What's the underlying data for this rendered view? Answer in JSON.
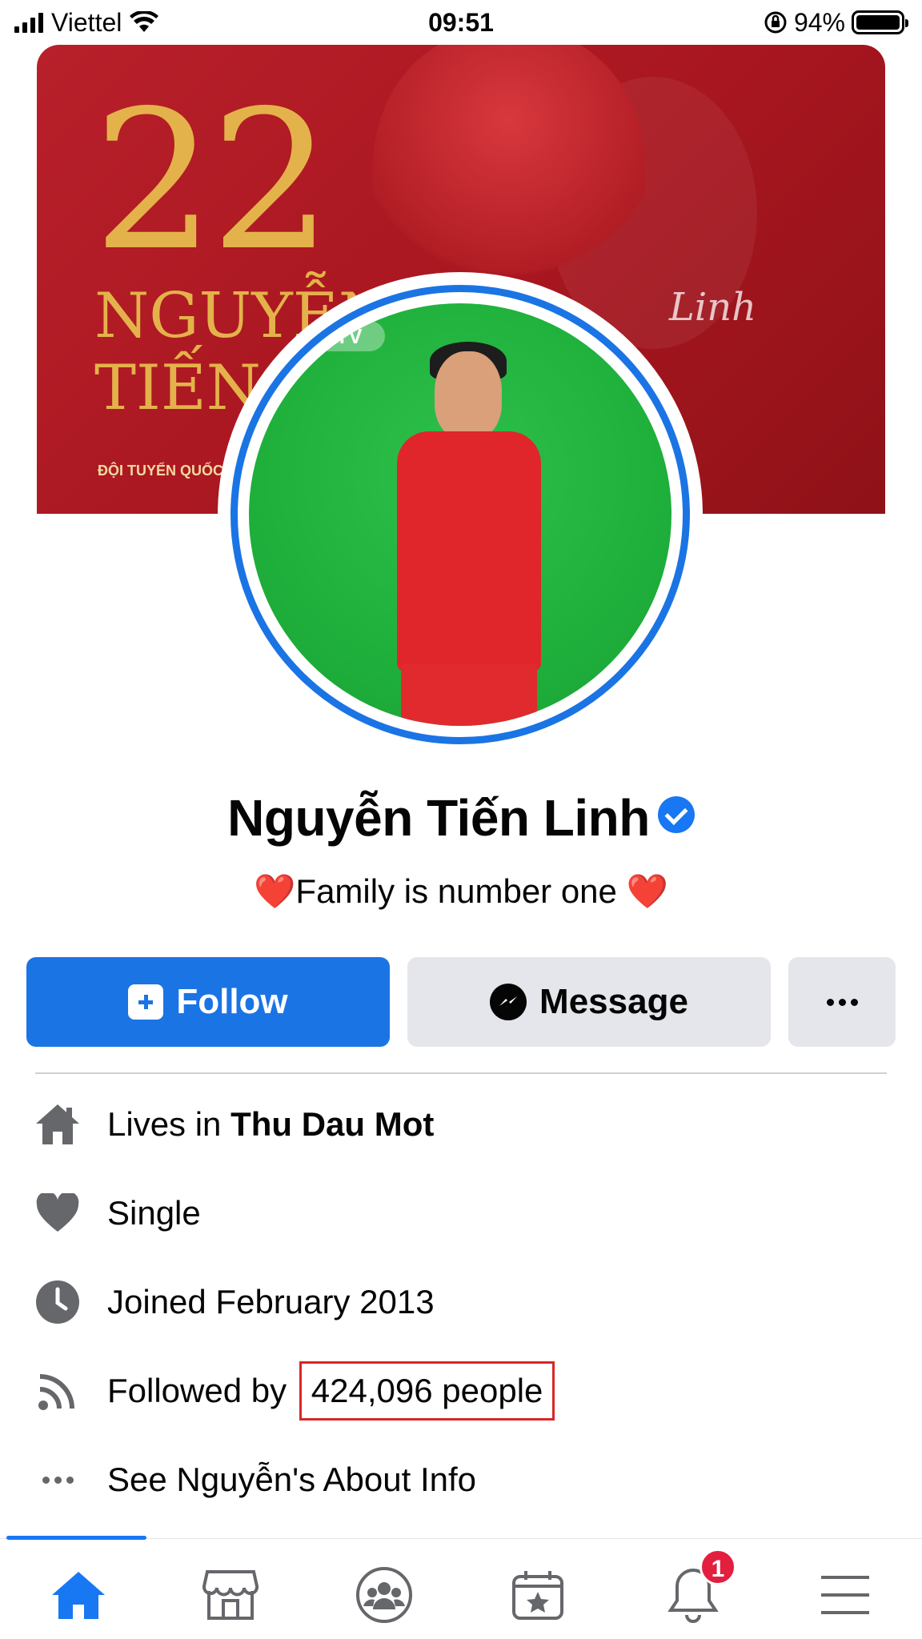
{
  "status_bar": {
    "carrier": "Viettel",
    "time": "09:51",
    "battery": "94%"
  },
  "cover": {
    "number": "22",
    "name_line1": "NGUYỄN",
    "name_line2": "TIẾN L",
    "caption": "ĐỘI TUYỂN QUỐC G",
    "signature": "Linh"
  },
  "avatar": {
    "logo_text": "TV"
  },
  "profile": {
    "name": "Nguyễn Tiến Linh",
    "bio": "❤️Family is number one ❤️"
  },
  "actions": {
    "follow": "Follow",
    "message": "Message"
  },
  "info": {
    "lives_prefix": "Lives in ",
    "lives_place": "Thu Dau Mot",
    "relationship": "Single",
    "joined": "Joined February 2013",
    "followed_prefix": "Followed by ",
    "followers": "424,096 people",
    "about": "See Nguyễn's About Info"
  },
  "tabbar": {
    "notification_count": "1",
    "accent_color": "#1877f2"
  },
  "icons": [
    "home-icon",
    "heart-icon",
    "clock-icon",
    "rss-icon",
    "more-dots-icon",
    "marketplace-icon",
    "groups-icon",
    "pages-icon",
    "bell-icon",
    "menu-icon"
  ]
}
